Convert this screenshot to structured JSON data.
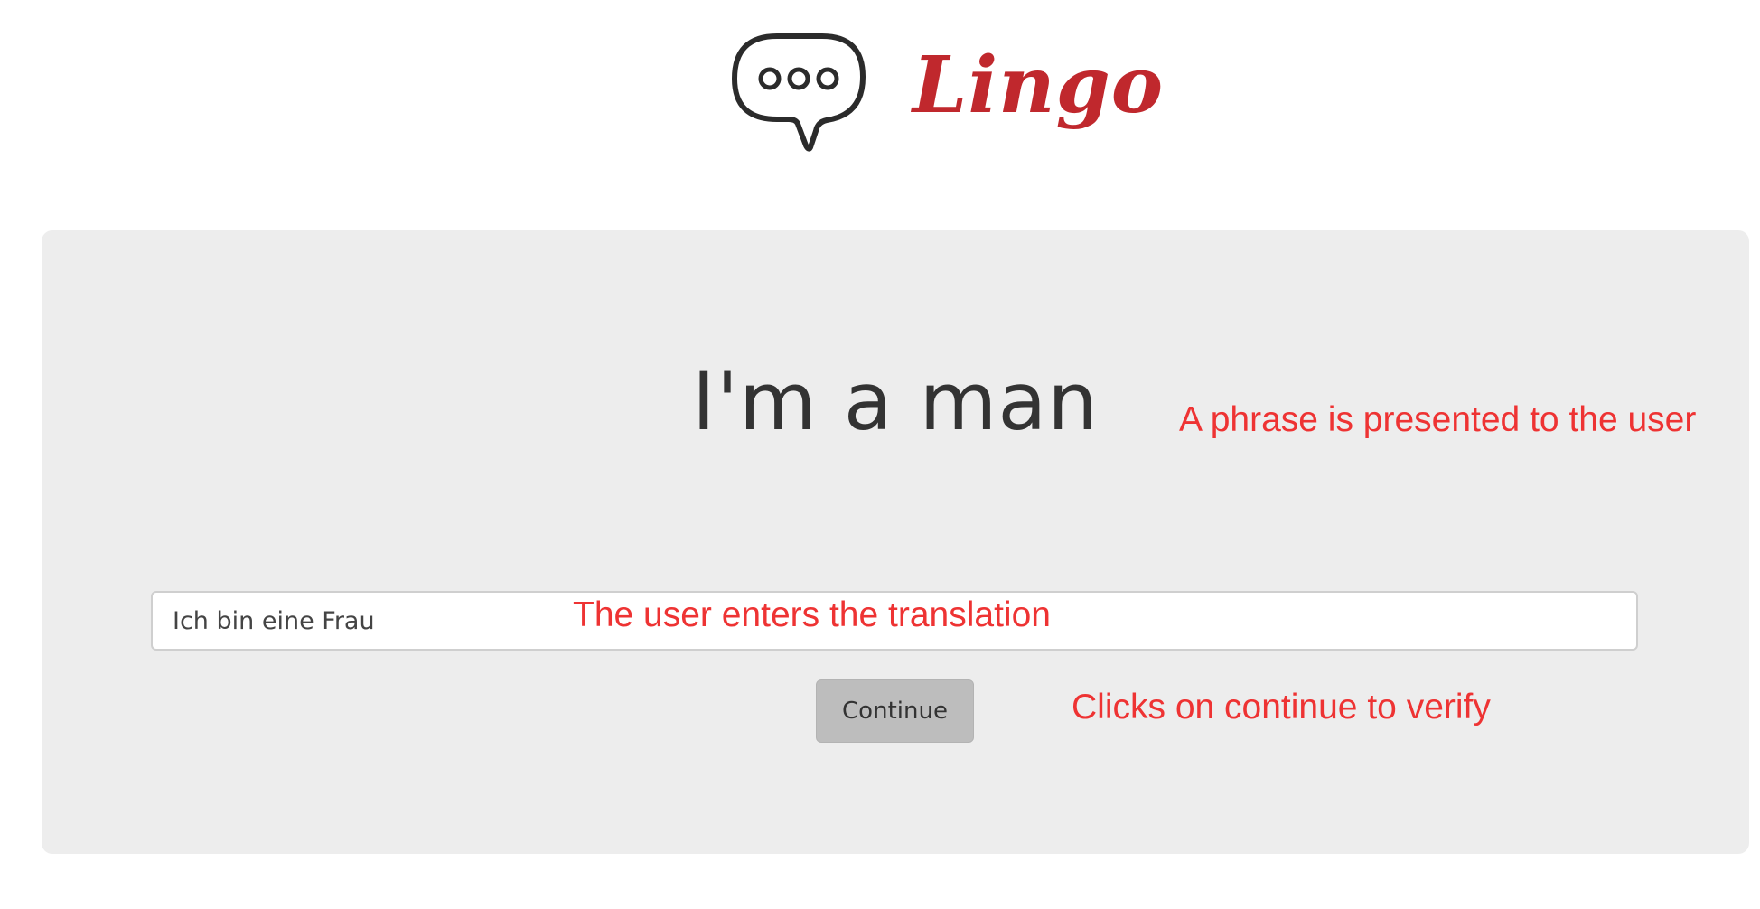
{
  "app": {
    "name": "Lingo",
    "icon": "speech-bubble-icon",
    "brand_color": "#c0282d"
  },
  "exercise": {
    "phrase": "I'm a man",
    "answer_value": "Ich bin eine Frau",
    "continue_label": "Continue"
  },
  "annotations": {
    "phrase_note": "A phrase is presented to the user",
    "input_note": "The user enters the translation",
    "button_note": "Clicks on continue to verify",
    "color": "#ee3333"
  }
}
